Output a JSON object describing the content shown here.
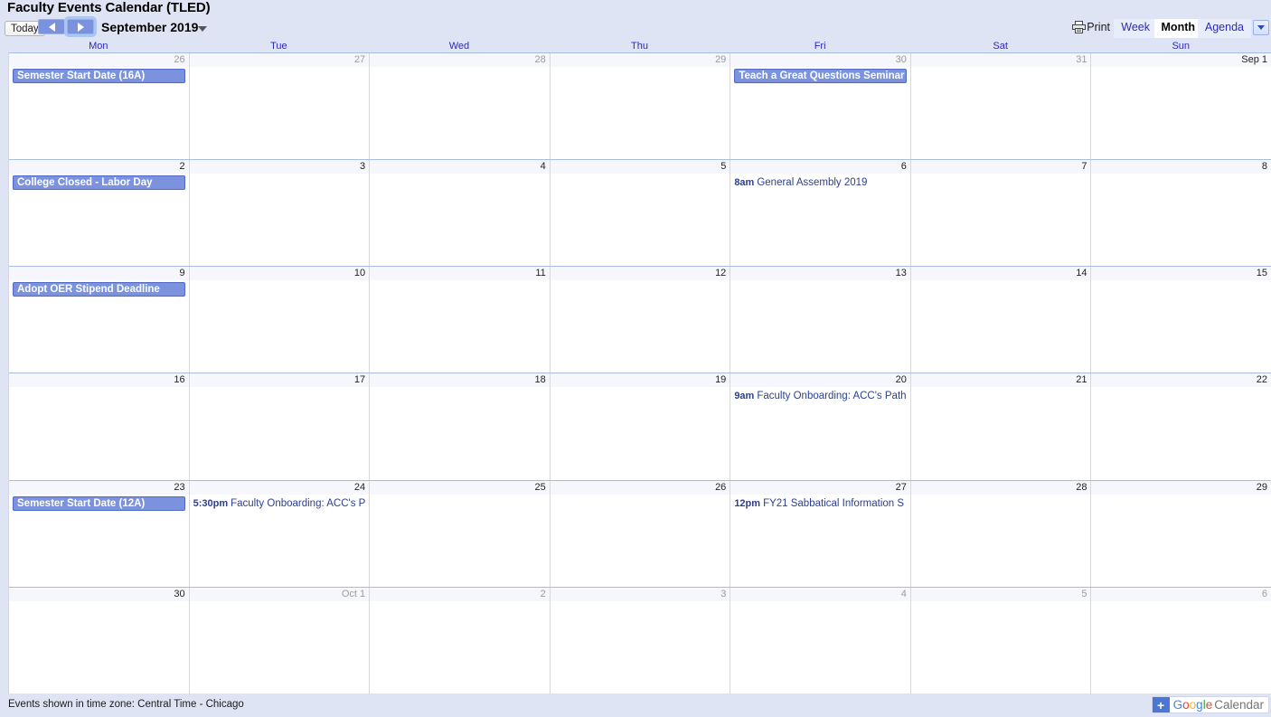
{
  "header": {
    "calendar_title": "Faculty Events Calendar (TLED)",
    "today_label": "Today",
    "prev_label": "Previous period",
    "next_label": "Next period",
    "period_label": "September 2019",
    "print_label": "Print",
    "views": [
      {
        "label": "Week",
        "active": false
      },
      {
        "label": "Month",
        "active": true
      },
      {
        "label": "Agenda",
        "active": false
      }
    ]
  },
  "weekdays": [
    "Mon",
    "Tue",
    "Wed",
    "Thu",
    "Fri",
    "Sat",
    "Sun"
  ],
  "weeks": [
    {
      "days": [
        {
          "num": "26",
          "other": true,
          "events": [
            {
              "type": "allday",
              "title": "Semester Start Date (16A)"
            }
          ]
        },
        {
          "num": "27",
          "other": true,
          "events": []
        },
        {
          "num": "28",
          "other": true,
          "events": []
        },
        {
          "num": "29",
          "other": true,
          "events": []
        },
        {
          "num": "30",
          "other": true,
          "events": [
            {
              "type": "allday",
              "title": "Teach a Great Questions Seminar ..."
            }
          ]
        },
        {
          "num": "31",
          "other": true,
          "events": []
        },
        {
          "num": "Sep 1",
          "other": false,
          "events": []
        }
      ]
    },
    {
      "days": [
        {
          "num": "2",
          "other": false,
          "events": [
            {
              "type": "allday",
              "title": "College Closed - Labor Day"
            }
          ]
        },
        {
          "num": "3",
          "other": false,
          "events": []
        },
        {
          "num": "4",
          "other": false,
          "events": []
        },
        {
          "num": "5",
          "other": false,
          "events": []
        },
        {
          "num": "6",
          "other": false,
          "events": [
            {
              "type": "timed",
              "time": "8am",
              "title": "General Assembly 2019"
            }
          ]
        },
        {
          "num": "7",
          "other": false,
          "events": []
        },
        {
          "num": "8",
          "other": false,
          "events": []
        }
      ]
    },
    {
      "days": [
        {
          "num": "9",
          "other": false,
          "events": [
            {
              "type": "allday",
              "title": "Adopt OER Stipend Deadline"
            }
          ]
        },
        {
          "num": "10",
          "other": false,
          "events": []
        },
        {
          "num": "11",
          "other": false,
          "events": []
        },
        {
          "num": "12",
          "other": false,
          "events": []
        },
        {
          "num": "13",
          "other": false,
          "events": []
        },
        {
          "num": "14",
          "other": false,
          "events": []
        },
        {
          "num": "15",
          "other": false,
          "events": []
        }
      ]
    },
    {
      "days": [
        {
          "num": "16",
          "other": false,
          "events": []
        },
        {
          "num": "17",
          "other": false,
          "events": []
        },
        {
          "num": "18",
          "other": false,
          "events": []
        },
        {
          "num": "19",
          "other": false,
          "events": []
        },
        {
          "num": "20",
          "other": false,
          "events": [
            {
              "type": "timed",
              "time": "9am",
              "title": "Faculty Onboarding: ACC's Path"
            }
          ]
        },
        {
          "num": "21",
          "other": false,
          "events": []
        },
        {
          "num": "22",
          "other": false,
          "events": []
        }
      ]
    },
    {
      "days": [
        {
          "num": "23",
          "other": false,
          "events": [
            {
              "type": "allday",
              "title": "Semester Start Date (12A)"
            }
          ]
        },
        {
          "num": "24",
          "other": false,
          "events": [
            {
              "type": "timed",
              "time": "5:30pm",
              "title": "Faculty Onboarding: ACC's P"
            }
          ]
        },
        {
          "num": "25",
          "other": false,
          "events": []
        },
        {
          "num": "26",
          "other": false,
          "events": []
        },
        {
          "num": "27",
          "other": false,
          "events": [
            {
              "type": "timed",
              "time": "12pm",
              "title": "FY21 Sabbatical Information S"
            }
          ]
        },
        {
          "num": "28",
          "other": false,
          "events": []
        },
        {
          "num": "29",
          "other": false,
          "events": []
        }
      ]
    },
    {
      "days": [
        {
          "num": "30",
          "other": false,
          "events": []
        },
        {
          "num": "Oct 1",
          "other": true,
          "events": []
        },
        {
          "num": "2",
          "other": true,
          "events": []
        },
        {
          "num": "3",
          "other": true,
          "events": []
        },
        {
          "num": "4",
          "other": true,
          "events": []
        },
        {
          "num": "5",
          "other": true,
          "events": []
        },
        {
          "num": "6",
          "other": true,
          "events": []
        }
      ]
    }
  ],
  "footer": {
    "timezone_note": "Events shown in time zone: Central Time - Chicago",
    "logo_plus": "+",
    "logo_google_letters": [
      "G",
      "o",
      "o",
      "g",
      "l",
      "e"
    ],
    "logo_word": "Calendar"
  },
  "colors": {
    "event_fill": "#7b93df",
    "event_border": "#4e6ac4",
    "accent_blue": "#2b2bbb",
    "page_bg": "#dfe4f5"
  }
}
